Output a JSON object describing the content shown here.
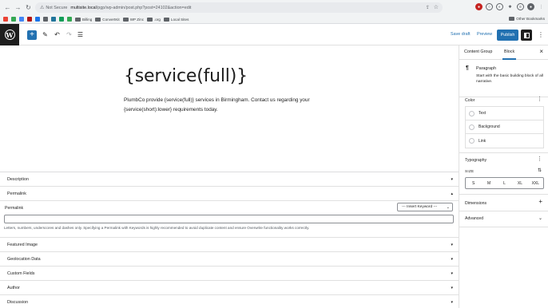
{
  "browser": {
    "url_warning": "Not Secure",
    "url_host": "multisite.local",
    "url_path": "/pgp/wp-admin/post.php?post=24102&action=edit",
    "bookmarks": [
      "Billing",
      "ConvertKit",
      "WP Zinc",
      ".org",
      "Local Sites"
    ],
    "other_bookmarks": "Other Bookmarks"
  },
  "toolbar": {
    "save_draft": "Save draft",
    "preview": "Preview",
    "publish": "Publish"
  },
  "editor": {
    "title": "{service(full)}",
    "paragraph": "PlumbCo provide {service(full)} services in Birmingham. Contact us regarding your {service(short):lower} requirements today."
  },
  "metaboxes": {
    "description": "Description",
    "permalink": "Permalink",
    "permalink_label": "Permalink",
    "insert_keyword": "--- Insert Keyword ---",
    "permalink_value": "",
    "permalink_help": "Letters, numbers, underscores and dashes only. Specifying a Permalink with Keywords is highly recommended to avoid duplicate content and ensure Overwrite functionality works correctly.",
    "featured_image": "Featured Image",
    "geolocation": "Geolocation Data",
    "custom_fields": "Custom Fields",
    "author": "Author",
    "discussion": "Discussion"
  },
  "sidebar": {
    "tabs": [
      "Content Group",
      "Block"
    ],
    "active_tab": "Block",
    "block_title": "Paragraph",
    "block_desc": "Start with the basic building block of all narrative.",
    "color_title": "Color",
    "color_options": [
      "Text",
      "Background",
      "Link"
    ],
    "typography_title": "Typography",
    "size_label": "SIZE",
    "sizes": [
      "S",
      "M",
      "L",
      "XL",
      "XXL"
    ],
    "dimensions": "Dimensions",
    "advanced": "Advanced"
  },
  "colors": {
    "accent": "#2271b1",
    "dark": "#1e1e1e"
  }
}
